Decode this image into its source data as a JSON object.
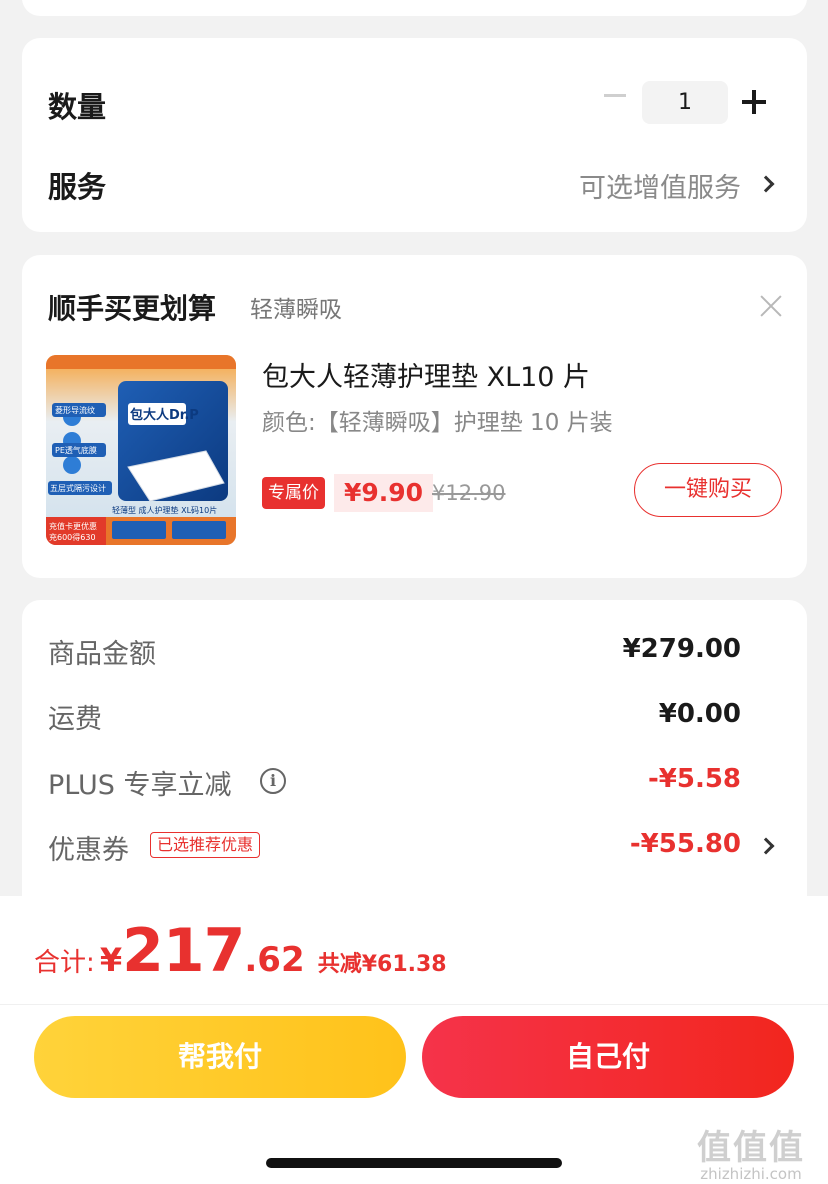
{
  "quantity_card": {
    "quantity_label": "数量",
    "quantity_value": "1",
    "service_label": "服务",
    "service_value": "可选增值服务"
  },
  "addon_card": {
    "title": "顺手买更划算",
    "subtitle": "轻薄瞬吸",
    "product": {
      "name": "包大人轻薄护理垫 XL10 片",
      "variant": "颜色:【轻薄瞬吸】护理垫 10 片装",
      "price_tag": "专属价",
      "price": "¥9.90",
      "original_price": "¥12.90",
      "buy_label": "一键购买",
      "image_brand": "包大人Dr.P",
      "image_caption": "轻薄型 成人护理垫 XL码10片",
      "image_features": [
        "菱形导流纹",
        "PE透气底膜",
        "五层式隔污设计"
      ],
      "image_promo": [
        "充值卡更优惠",
        "充600得630"
      ]
    }
  },
  "fee_card": {
    "rows": [
      {
        "label": "商品金额",
        "value": "¥279.00"
      },
      {
        "label": "运费",
        "value": "¥0.00"
      },
      {
        "label": "PLUS 专享立减",
        "value": "-¥5.58"
      },
      {
        "label": "优惠券",
        "value": "-¥55.80",
        "badge": "已选推荐优惠"
      }
    ]
  },
  "bottom_bar": {
    "total_label": "合计:",
    "total_currency": "¥",
    "total_integer": "217",
    "total_decimal": ".62",
    "total_saved": "共减¥61.38",
    "pay_friend_label": "帮我付",
    "pay_self_label": "自己付"
  },
  "watermark": {
    "glyphs": "值值值",
    "text": "zhizhizhi.com"
  },
  "colors": {
    "accent_red": "#e8312f",
    "yellow_button": "#ffc21a",
    "red_button": "#f2261e",
    "background": "#f2f2f2"
  }
}
